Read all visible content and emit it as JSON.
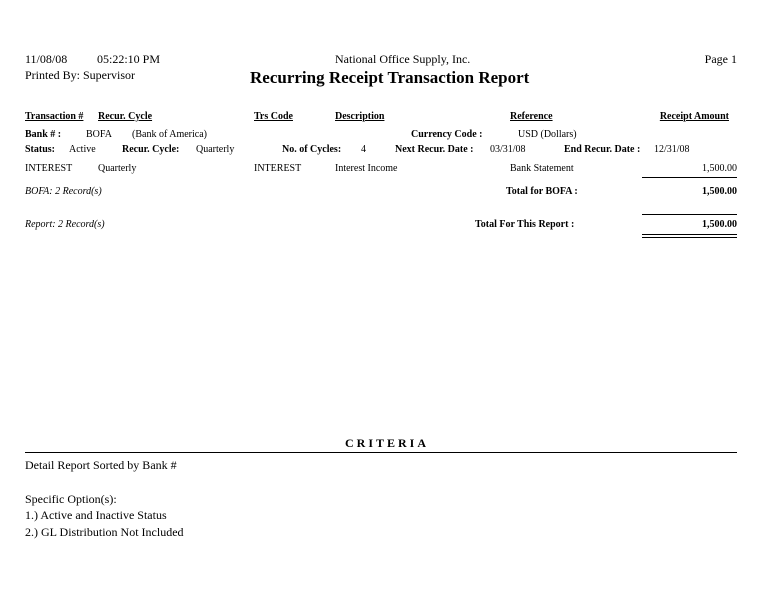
{
  "header": {
    "date": "11/08/08",
    "time": "05:22:10 PM",
    "printed_by": "Printed By: Supervisor",
    "company": "National Office Supply, Inc.",
    "title": "Recurring Receipt Transaction Report",
    "page": "Page 1"
  },
  "columns": {
    "transaction": "Transaction #",
    "recur_cycle": "Recur. Cycle",
    "trs_code": "Trs Code",
    "description": "Description",
    "reference": "Reference",
    "receipt_amount": "Receipt Amount"
  },
  "bank_group": {
    "bank_label": "Bank # :",
    "bank_code": "BOFA",
    "bank_name": "(Bank of America)",
    "currency_label": "Currency Code :",
    "currency_value": "USD (Dollars)",
    "status_label": "Status:",
    "status_value": "Active",
    "recur_cycle_label": "Recur. Cycle:",
    "recur_cycle_value": "Quarterly",
    "cycles_label": "No. of Cycles:",
    "cycles_value": "4",
    "next_date_label": "Next Recur. Date :",
    "next_date_value": "03/31/08",
    "end_date_label": "End Recur. Date :",
    "end_date_value": "12/31/08",
    "rows": [
      {
        "transaction": "INTEREST",
        "recur_cycle": "Quarterly",
        "trs_code": "INTEREST",
        "description": "Interest Income",
        "reference": "Bank Statement",
        "amount": "1,500.00"
      }
    ],
    "record_count": "BOFA: 2 Record(s)",
    "total_label": "Total for BOFA :",
    "total_value": "1,500.00"
  },
  "report_total": {
    "record_count": "Report: 2 Record(s)",
    "label": "Total For This Report :",
    "value": "1,500.00"
  },
  "criteria": {
    "title": "CRITERIA",
    "sort_line": "Detail Report Sorted by Bank #",
    "options_label": "Specific Option(s):",
    "options": [
      "1.) Active and Inactive Status",
      "2.) GL Distribution Not Included"
    ]
  }
}
